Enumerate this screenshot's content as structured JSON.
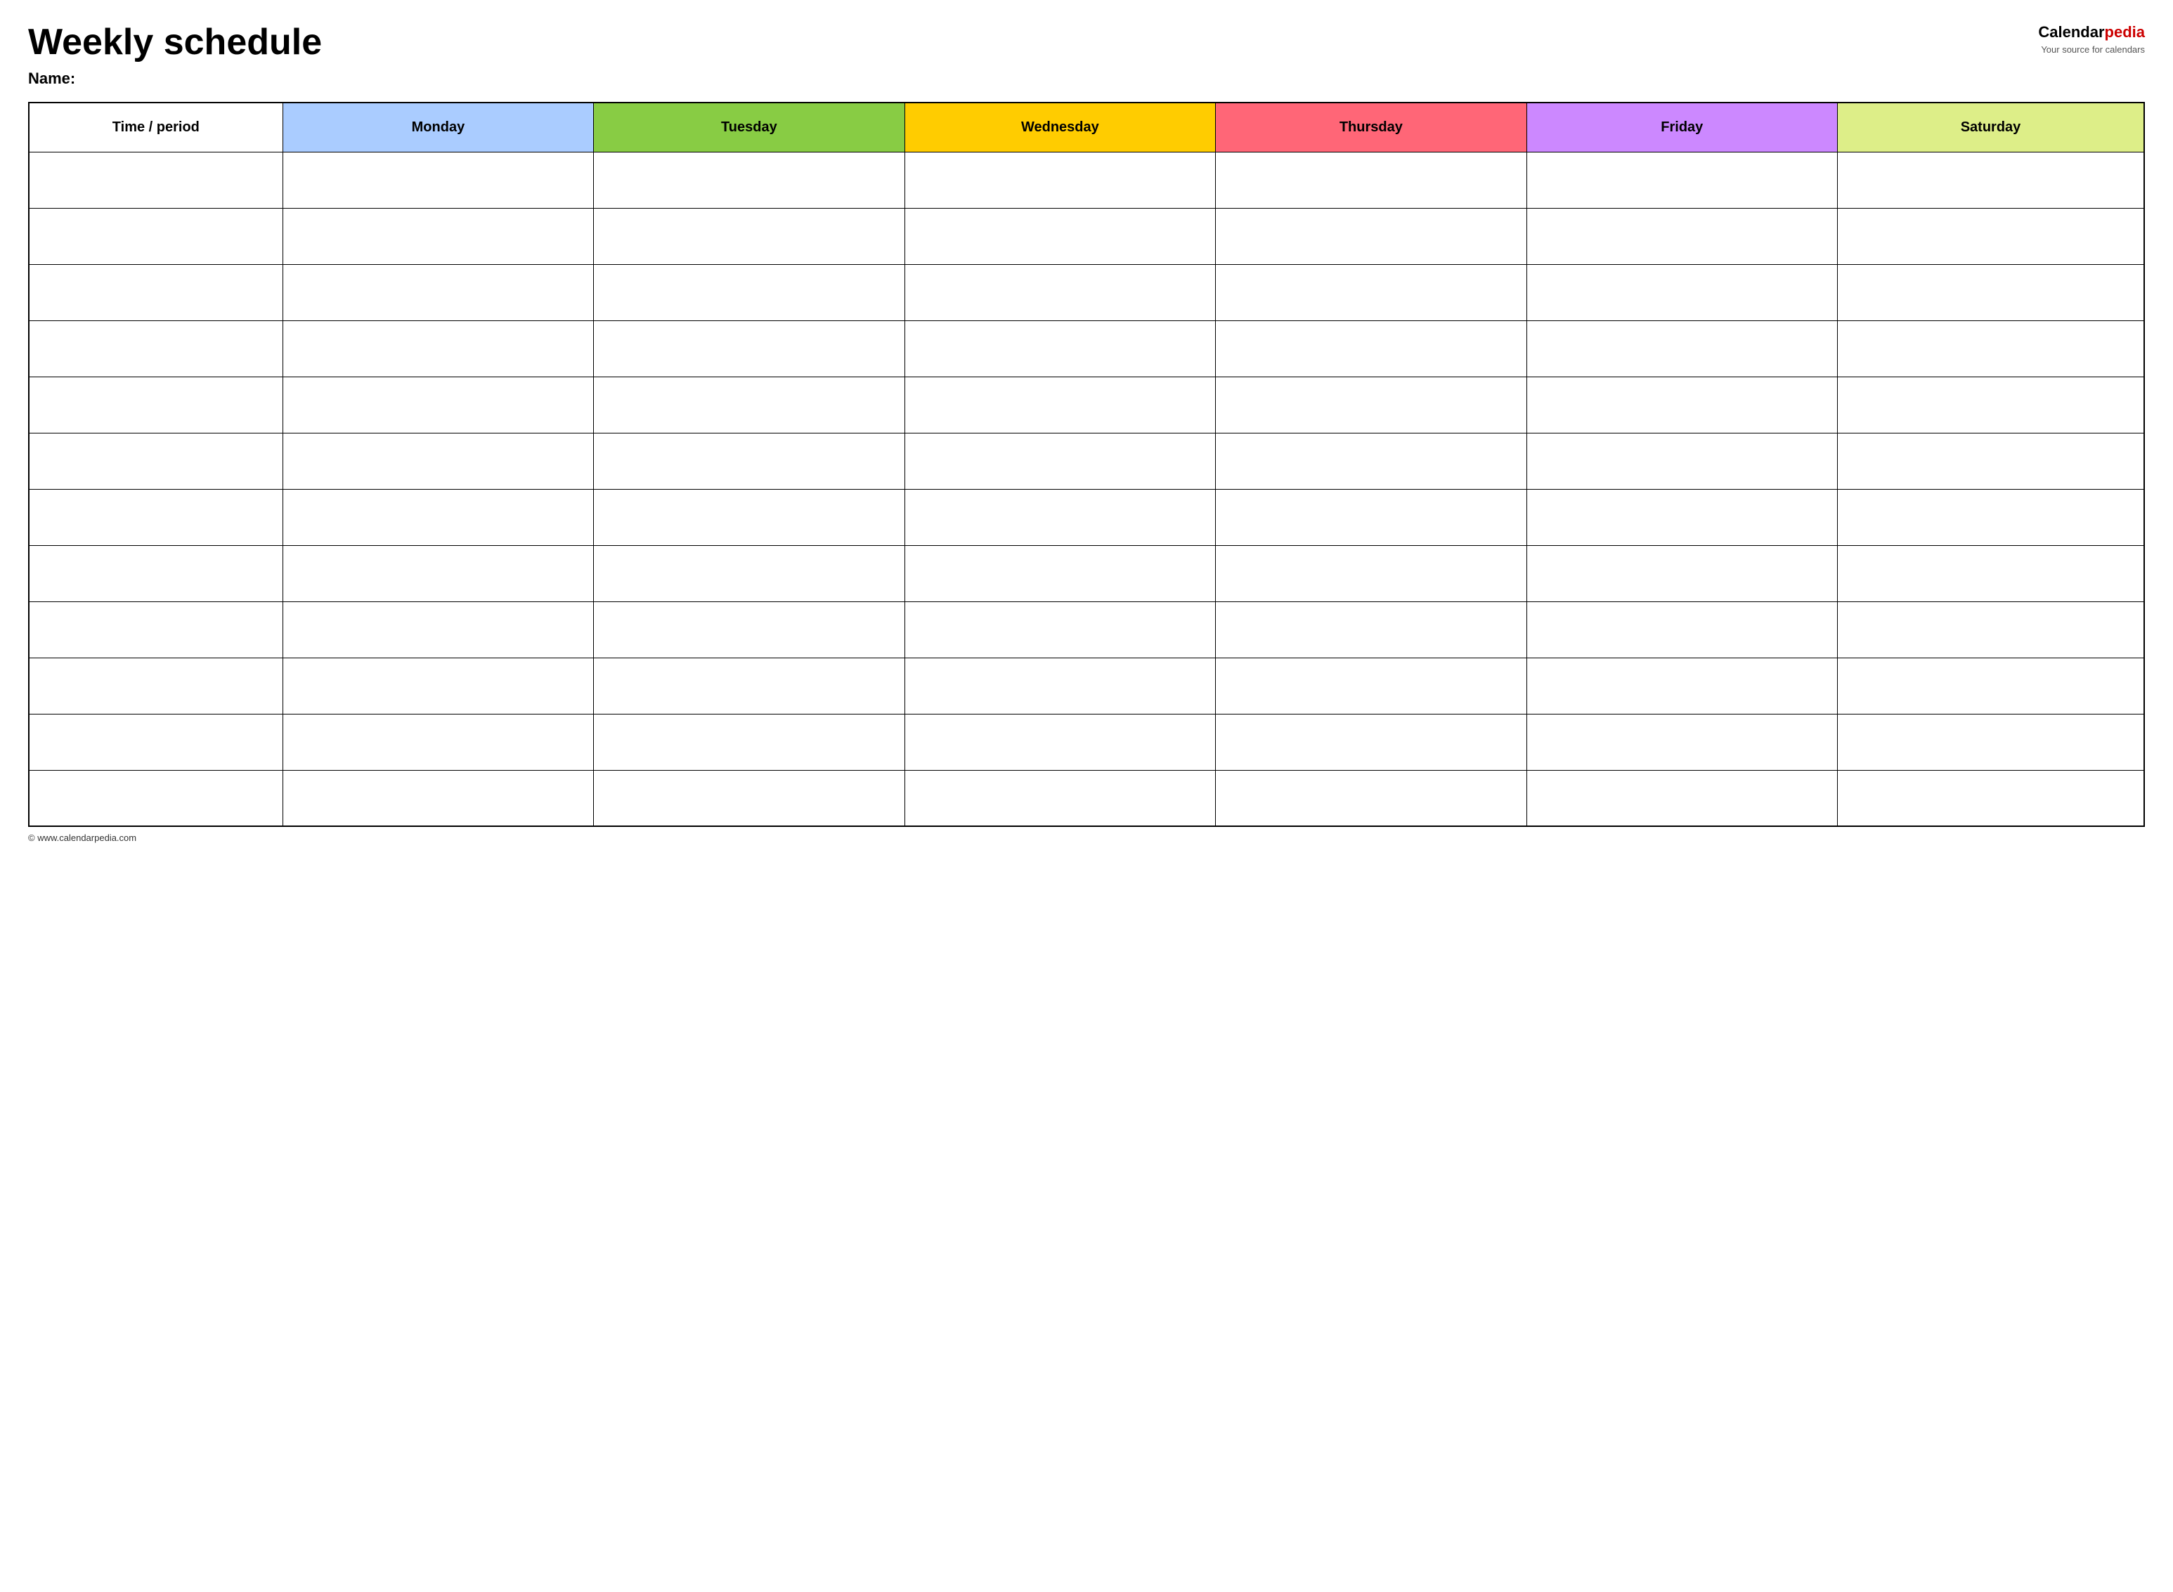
{
  "header": {
    "title": "Weekly schedule",
    "name_label": "Name:",
    "logo_calendar": "Calendar",
    "logo_pedia": "pedia",
    "logo_tagline": "Your source for calendars"
  },
  "table": {
    "columns": [
      {
        "id": "time",
        "label": "Time / period",
        "color": "#ffffff"
      },
      {
        "id": "monday",
        "label": "Monday",
        "color": "#aaccff"
      },
      {
        "id": "tuesday",
        "label": "Tuesday",
        "color": "#88cc44"
      },
      {
        "id": "wednesday",
        "label": "Wednesday",
        "color": "#ffcc00"
      },
      {
        "id": "thursday",
        "label": "Thursday",
        "color": "#ff6677"
      },
      {
        "id": "friday",
        "label": "Friday",
        "color": "#cc88ff"
      },
      {
        "id": "saturday",
        "label": "Saturday",
        "color": "#ddee88"
      }
    ],
    "row_count": 12
  },
  "footer": {
    "url": "© www.calendarpedia.com"
  }
}
